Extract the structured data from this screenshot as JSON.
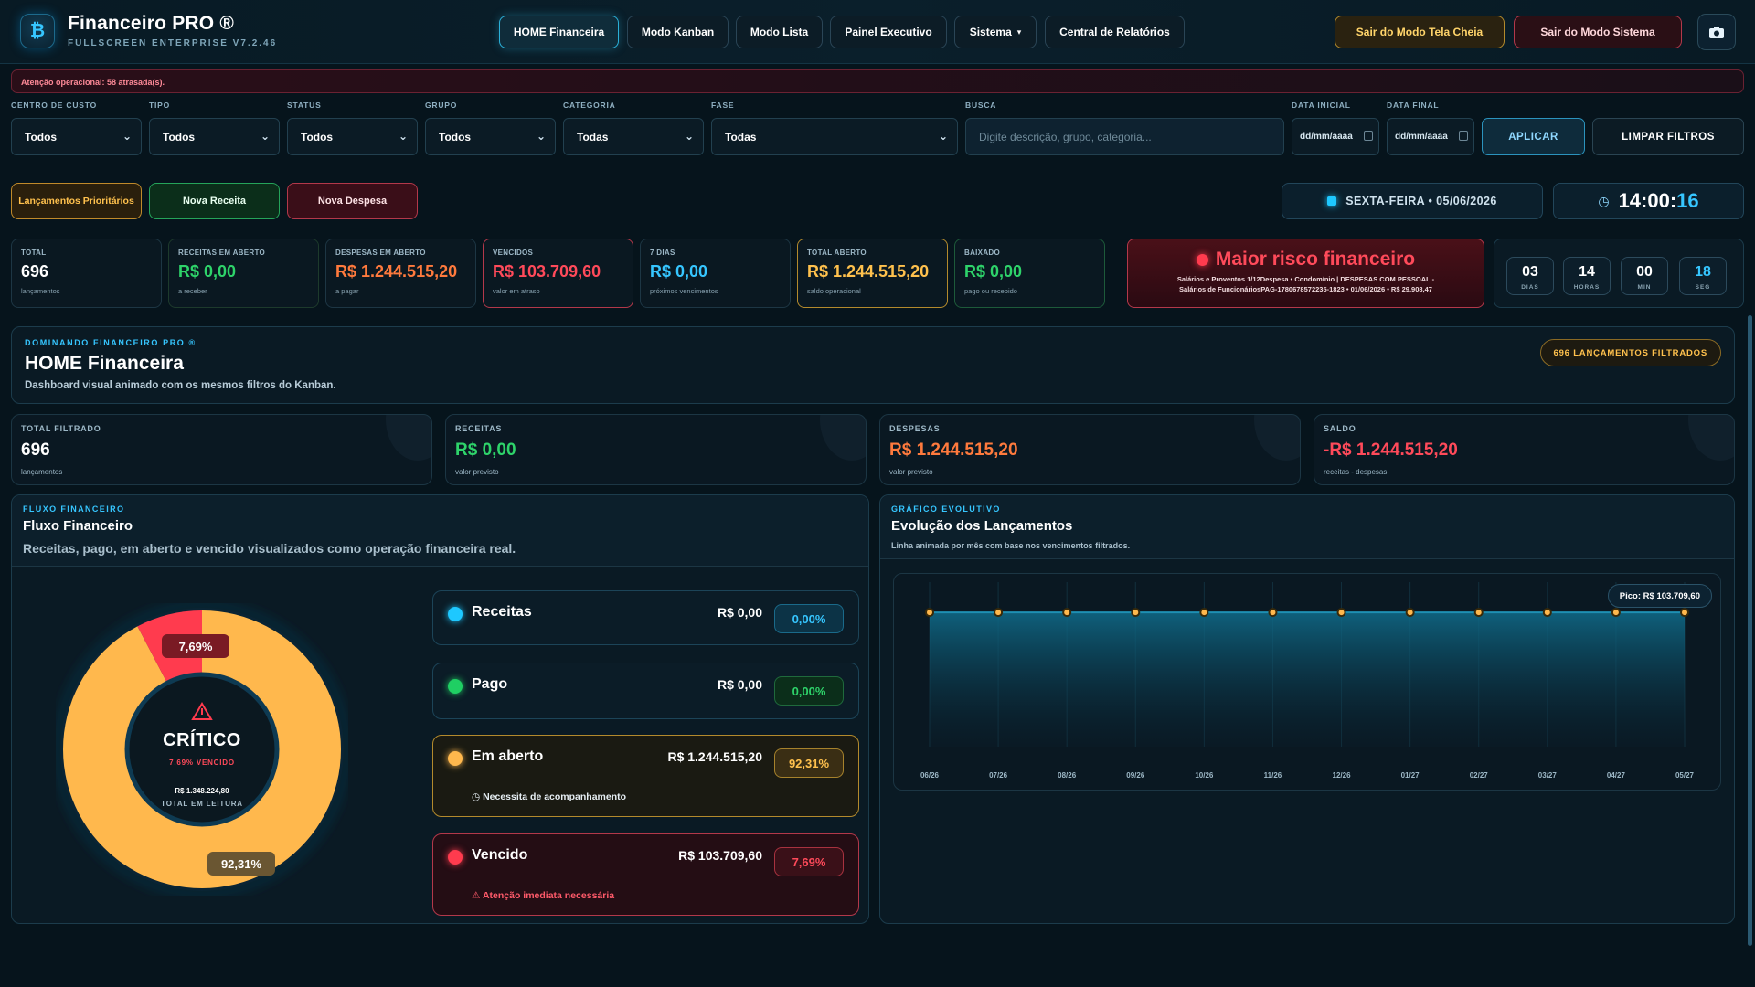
{
  "app": {
    "title": "Financeiro PRO ®",
    "subtitle": "FULLSCREEN ENTERPRISE V7.2.46",
    "logo_glyph": "₿"
  },
  "nav": {
    "home": "HOME Financeira",
    "kanban": "Modo Kanban",
    "lista": "Modo Lista",
    "painel": "Painel Executivo",
    "sistema": "Sistema",
    "sistema_caret": "▾",
    "relatorios": "Central de Relatórios",
    "sair_tela_cheia": "Sair do Modo Tela Cheia",
    "sair_sistema": "Sair do Modo Sistema"
  },
  "alert": {
    "text": "Atenção operacional: 58 atrasada(s)."
  },
  "filters": {
    "centro_custo": {
      "label": "CENTRO DE CUSTO",
      "value": "Todos"
    },
    "tipo": {
      "label": "TIPO",
      "value": "Todos"
    },
    "status": {
      "label": "STATUS",
      "value": "Todos"
    },
    "grupo": {
      "label": "GRUPO",
      "value": "Todos"
    },
    "categoria": {
      "label": "CATEGORIA",
      "value": "Todas"
    },
    "fase": {
      "label": "FASE",
      "value": "Todas"
    },
    "busca": {
      "label": "BUSCA",
      "placeholder": "Digite descrição, grupo, categoria..."
    },
    "data_inicial": {
      "label": "DATA INICIAL",
      "value": "dd/mm/aaaa"
    },
    "data_final": {
      "label": "DATA FINAL",
      "value": "dd/mm/aaaa"
    },
    "apply": "APLICAR",
    "clear": "LIMPAR FILTROS"
  },
  "actions": {
    "prioritarios": "Lançamentos Prioritários",
    "nova_receita": "Nova Receita",
    "nova_despesa": "Nova Despesa"
  },
  "datetime": {
    "date": "SEXTA-FEIRA • 05/06/2026",
    "time_hm": "14:00:",
    "time_s": "16"
  },
  "kpis": [
    {
      "label": "TOTAL",
      "value": "696",
      "sub": "lançamentos",
      "color": "#ffffff"
    },
    {
      "label": "RECEITAS EM ABERTO",
      "value": "R$ 0,00",
      "sub": "a receber",
      "color": "#2ed36a"
    },
    {
      "label": "DESPESAS EM ABERTO",
      "value": "R$ 1.244.515,20",
      "sub": "a pagar",
      "color": "#ff7a3d"
    },
    {
      "label": "VENCIDOS",
      "value": "R$ 103.709,60",
      "sub": "valor em atraso",
      "color": "#ff4a5a"
    },
    {
      "label": "7 DIAS",
      "value": "R$ 0,00",
      "sub": "próximos vencimentos",
      "color": "#36c6ff"
    },
    {
      "label": "TOTAL ABERTO",
      "value": "R$ 1.244.515,20",
      "sub": "saldo operacional",
      "color": "#ffc14d"
    },
    {
      "label": "BAIXADO",
      "value": "R$ 0,00",
      "sub": "pago ou recebido",
      "color": "#2ed36a"
    }
  ],
  "risk": {
    "title": "Maior risco financeiro",
    "line1": "Salários e Proventos 1/12Despesa • Condomínio | DESPESAS COM PESSOAL -",
    "line2": "Salários de FuncionáriosPAG-1780678572235-1823 • 01/06/2026 • R$ 29.908,47"
  },
  "countdown": [
    {
      "n": "03",
      "u": "DIAS"
    },
    {
      "n": "14",
      "u": "HORAS"
    },
    {
      "n": "00",
      "u": "MIN"
    },
    {
      "n": "18",
      "u": "SEG"
    }
  ],
  "hero": {
    "kicker": "DOMINANDO FINANCEIRO PRO ®",
    "title": "HOME Financeira",
    "desc": "Dashboard visual animado com os mesmos filtros do Kanban.",
    "badge": "696 LANÇAMENTOS FILTRADOS"
  },
  "summary": [
    {
      "label": "TOTAL FILTRADO",
      "value": "696",
      "sub": "lançamentos",
      "color": "#ffffff"
    },
    {
      "label": "RECEITAS",
      "value": "R$ 0,00",
      "sub": "valor previsto",
      "color": "#2ed36a"
    },
    {
      "label": "DESPESAS",
      "value": "R$ 1.244.515,20",
      "sub": "valor previsto",
      "color": "#ff7a3d"
    },
    {
      "label": "SALDO",
      "value": "-R$ 1.244.515,20",
      "sub": "receitas - despesas",
      "color": "#ff4a5a"
    }
  ],
  "flow": {
    "kicker": "FLUXO FINANCEIRO",
    "title": "Fluxo Financeiro",
    "desc": "Receitas, pago, em aberto e vencido visualizados como operação financeira real.",
    "center": {
      "status": "CRÍTICO",
      "vencido": "7,69% VENCIDO",
      "total": "R$ 1.348.224,80",
      "total_label": "TOTAL EM LEITURA"
    },
    "donut_labels": {
      "vencido": "7,69%",
      "aberto": "92,31%"
    },
    "items": [
      {
        "name": "Receitas",
        "amount": "R$ 0,00",
        "pct": "0,00%",
        "color": "#1ec8ff",
        "note": ""
      },
      {
        "name": "Pago",
        "amount": "R$ 0,00",
        "pct": "0,00%",
        "color": "#1fcf63",
        "note": ""
      },
      {
        "name": "Em aberto",
        "amount": "R$ 1.244.515,20",
        "pct": "92,31%",
        "color": "#ffb84d",
        "note": "◷ Necessita de acompanhamento"
      },
      {
        "name": "Vencido",
        "amount": "R$ 103.709,60",
        "pct": "7,69%",
        "color": "#ff3b4e",
        "note": "⚠ Atenção imediata necessária"
      }
    ]
  },
  "evo": {
    "kicker": "GRÁFICO EVOLUTIVO",
    "title": "Evolução dos Lançamentos",
    "desc": "Linha animada por mês com base nos vencimentos filtrados.",
    "peak": "Pico: R$ 103.709,60"
  },
  "chart_data": [
    {
      "type": "pie",
      "labels": [
        "Em aberto",
        "Vencido"
      ],
      "values": [
        92.31,
        7.69
      ],
      "colors": [
        "#ffb84d",
        "#ff3b4e"
      ]
    },
    {
      "type": "area",
      "categories": [
        "06/26",
        "07/26",
        "08/26",
        "09/26",
        "10/26",
        "11/26",
        "12/26",
        "01/27",
        "02/27",
        "03/27",
        "04/27",
        "05/27"
      ],
      "values": [
        103709.6,
        103709.6,
        103709.6,
        103709.6,
        103709.6,
        103709.6,
        103709.6,
        103709.6,
        103709.6,
        103709.6,
        103709.6,
        103709.6
      ],
      "ylim": [
        0,
        120000
      ]
    }
  ]
}
